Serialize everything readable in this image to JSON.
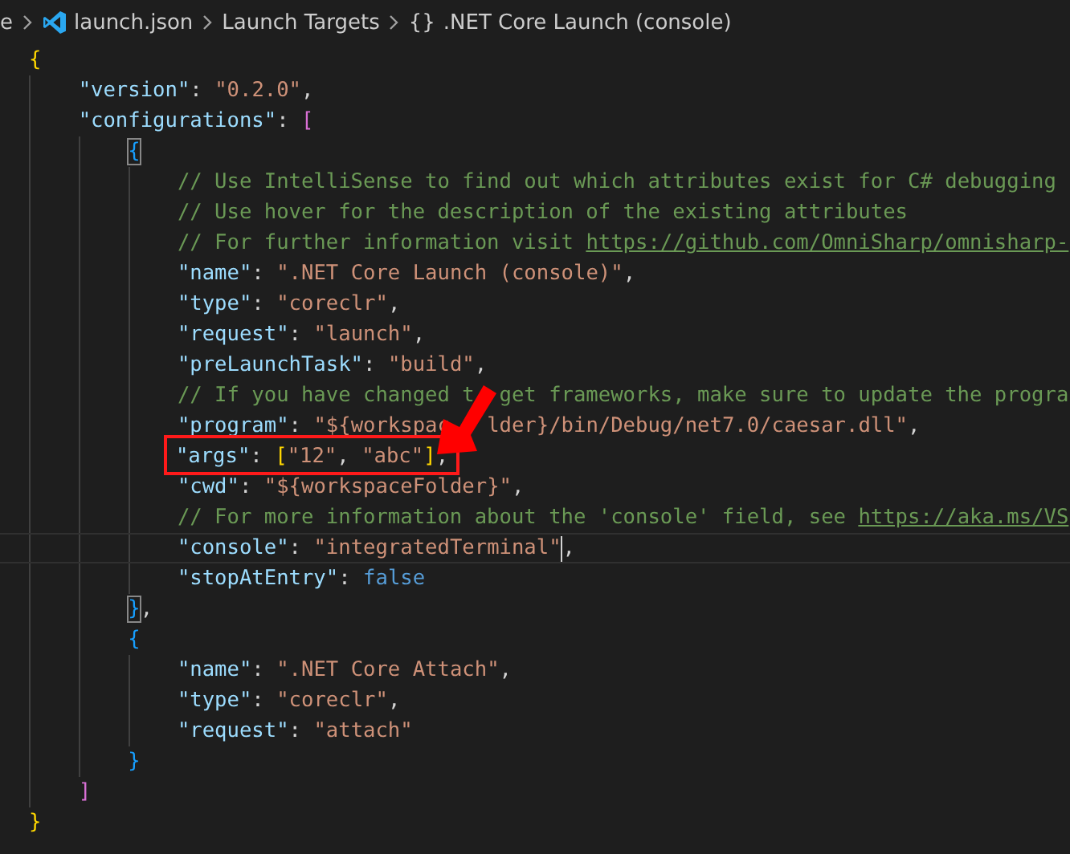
{
  "breadcrumb": [
    {
      "kind": "text",
      "label": "e"
    },
    {
      "kind": "file",
      "label": "launch.json"
    },
    {
      "kind": "text",
      "label": "Launch Targets"
    },
    {
      "kind": "symbol",
      "icon": "{}",
      "label": ".NET Core Launch (console)"
    }
  ],
  "lines": [
    {
      "tokens": [
        {
          "kind": "bracket",
          "text": "{",
          "color": "#ffd700"
        }
      ],
      "children": [
        {
          "tokens": [
            {
              "kind": "key",
              "text": "\"version\""
            },
            {
              "kind": "punct",
              "text": ": "
            },
            {
              "kind": "string",
              "text": "\"0.2.0\""
            },
            {
              "kind": "punct",
              "text": ","
            }
          ]
        },
        {
          "tokens": [
            {
              "kind": "key",
              "text": "\"configurations\""
            },
            {
              "kind": "punct",
              "text": ": "
            },
            {
              "kind": "bracket",
              "text": "[",
              "color": "#da70d6"
            }
          ],
          "children": [
            {
              "tokens": [
                {
                  "kind": "bracket",
                  "text": "{",
                  "color": "#179fff",
                  "matched": true
                }
              ],
              "children": [
                {
                  "tokens": [
                    {
                      "kind": "comment",
                      "text": "// Use IntelliSense to find out which attributes exist for C# debugging"
                    }
                  ]
                },
                {
                  "tokens": [
                    {
                      "kind": "comment",
                      "text": "// Use hover for the description of the existing attributes"
                    }
                  ]
                },
                {
                  "tokens": [
                    {
                      "kind": "comment",
                      "text": "// For further information visit "
                    },
                    {
                      "kind": "link",
                      "text": "https://github.com/OmniSharp/omnisharp-"
                    }
                  ]
                },
                {
                  "tokens": [
                    {
                      "kind": "key",
                      "text": "\"name\""
                    },
                    {
                      "kind": "punct",
                      "text": ": "
                    },
                    {
                      "kind": "string",
                      "text": "\".NET Core Launch (console)\""
                    },
                    {
                      "kind": "punct",
                      "text": ","
                    }
                  ]
                },
                {
                  "tokens": [
                    {
                      "kind": "key",
                      "text": "\"type\""
                    },
                    {
                      "kind": "punct",
                      "text": ": "
                    },
                    {
                      "kind": "string",
                      "text": "\"coreclr\""
                    },
                    {
                      "kind": "punct",
                      "text": ","
                    }
                  ]
                },
                {
                  "tokens": [
                    {
                      "kind": "key",
                      "text": "\"request\""
                    },
                    {
                      "kind": "punct",
                      "text": ": "
                    },
                    {
                      "kind": "string",
                      "text": "\"launch\""
                    },
                    {
                      "kind": "punct",
                      "text": ","
                    }
                  ]
                },
                {
                  "tokens": [
                    {
                      "kind": "key",
                      "text": "\"preLaunchTask\""
                    },
                    {
                      "kind": "punct",
                      "text": ": "
                    },
                    {
                      "kind": "string",
                      "text": "\"build\""
                    },
                    {
                      "kind": "punct",
                      "text": ","
                    }
                  ]
                },
                {
                  "tokens": [
                    {
                      "kind": "comment",
                      "text": "// If you have changed t"
                    },
                    {
                      "kind": "comment",
                      "text": "get frameworks, make sure to update the progra",
                      "covered_before": true
                    }
                  ]
                },
                {
                  "tokens": [
                    {
                      "kind": "key",
                      "text": "\"program\""
                    },
                    {
                      "kind": "punct",
                      "text": ": "
                    },
                    {
                      "kind": "string",
                      "text": "\"${workspac"
                    },
                    {
                      "kind": "string",
                      "text": "lder}/bin/Debug/net7.0/caesar.dll\"",
                      "covered_before": true
                    },
                    {
                      "kind": "punct",
                      "text": ","
                    }
                  ]
                },
                {
                  "highlighted": true,
                  "tokens": [
                    {
                      "kind": "key",
                      "text": "\"args\""
                    },
                    {
                      "kind": "punct",
                      "text": ": "
                    },
                    {
                      "kind": "bracket",
                      "text": "[",
                      "color": "#ffd700"
                    },
                    {
                      "kind": "string",
                      "text": "\"12\""
                    },
                    {
                      "kind": "punct",
                      "text": ", "
                    },
                    {
                      "kind": "string",
                      "text": "\"abc\""
                    },
                    {
                      "kind": "bracket",
                      "text": "]",
                      "color": "#ffd700"
                    },
                    {
                      "kind": "punct",
                      "text": ","
                    }
                  ]
                },
                {
                  "tokens": [
                    {
                      "kind": "key",
                      "text": "\"cwd\""
                    },
                    {
                      "kind": "punct",
                      "text": ": "
                    },
                    {
                      "kind": "string",
                      "text": "\"${workspaceFolder}\""
                    },
                    {
                      "kind": "punct",
                      "text": ","
                    }
                  ]
                },
                {
                  "tokens": [
                    {
                      "kind": "comment",
                      "text": "// For more information about the 'console' field, see "
                    },
                    {
                      "kind": "link",
                      "text": "https://aka.ms/VS"
                    }
                  ]
                },
                {
                  "current": true,
                  "tokens": [
                    {
                      "kind": "key",
                      "text": "\"console\""
                    },
                    {
                      "kind": "punct",
                      "text": ": "
                    },
                    {
                      "kind": "string",
                      "text": "\"integratedTerminal\"",
                      "cursor": true
                    },
                    {
                      "kind": "punct",
                      "text": ","
                    }
                  ]
                },
                {
                  "tokens": [
                    {
                      "kind": "key",
                      "text": "\"stopAtEntry\""
                    },
                    {
                      "kind": "punct",
                      "text": ": "
                    },
                    {
                      "kind": "keyword",
                      "text": "false"
                    }
                  ]
                }
              ]
            },
            {
              "tokens": [
                {
                  "kind": "bracket",
                  "text": "}",
                  "color": "#179fff",
                  "matched": true
                },
                {
                  "kind": "punct",
                  "text": ","
                }
              ]
            },
            {
              "tokens": [
                {
                  "kind": "bracket",
                  "text": "{",
                  "color": "#179fff"
                }
              ],
              "children": [
                {
                  "tokens": [
                    {
                      "kind": "key",
                      "text": "\"name\""
                    },
                    {
                      "kind": "punct",
                      "text": ": "
                    },
                    {
                      "kind": "string",
                      "text": "\".NET Core Attach\""
                    },
                    {
                      "kind": "punct",
                      "text": ","
                    }
                  ]
                },
                {
                  "tokens": [
                    {
                      "kind": "key",
                      "text": "\"type\""
                    },
                    {
                      "kind": "punct",
                      "text": ": "
                    },
                    {
                      "kind": "string",
                      "text": "\"coreclr\""
                    },
                    {
                      "kind": "punct",
                      "text": ","
                    }
                  ]
                },
                {
                  "tokens": [
                    {
                      "kind": "key",
                      "text": "\"request\""
                    },
                    {
                      "kind": "punct",
                      "text": ": "
                    },
                    {
                      "kind": "string",
                      "text": "\"attach\""
                    }
                  ]
                }
              ]
            },
            {
              "tokens": [
                {
                  "kind": "bracket",
                  "text": "}",
                  "color": "#179fff"
                }
              ]
            }
          ]
        },
        {
          "tokens": [
            {
              "kind": "bracket",
              "text": "]",
              "color": "#da70d6"
            }
          ]
        }
      ]
    },
    {
      "tokens": [
        {
          "kind": "bracket",
          "text": "}",
          "color": "#ffd700"
        }
      ]
    }
  ]
}
